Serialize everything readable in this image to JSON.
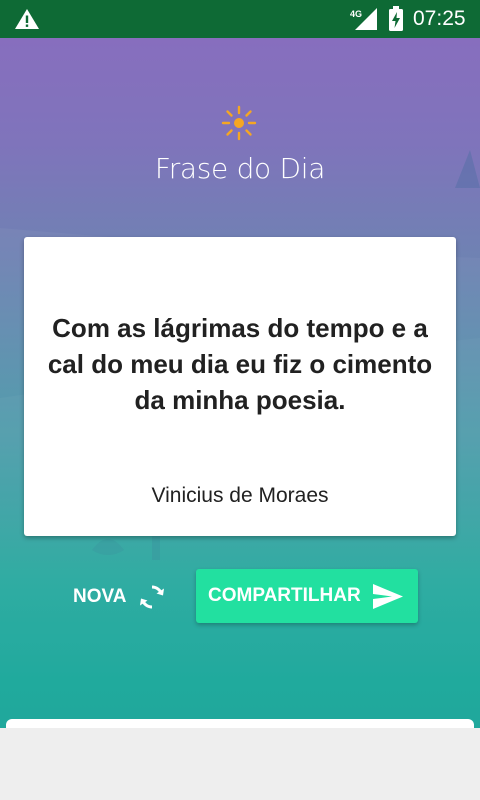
{
  "status_bar": {
    "time": "07:25",
    "network_label": "4G",
    "warning_icon": "warning-icon",
    "signal_icon": "signal-icon",
    "battery_icon": "battery-charging-icon"
  },
  "header": {
    "icon": "sun-icon",
    "title": "Frase do Dia"
  },
  "quote": {
    "text": "Com as lágrimas do tempo e a cal do meu dia eu fiz o cimento da minha poesia.",
    "author": "Vinicius de Moraes"
  },
  "actions": {
    "new_label": "NOVA",
    "new_icon": "refresh-icon",
    "share_label": "COMPARTILHAR",
    "share_icon": "send-icon"
  },
  "colors": {
    "status_bar": "#0e6a35",
    "accent": "#22e0a0",
    "sun": "#f5a623",
    "gradient_top": "#8a6cbf",
    "gradient_bottom": "#0f9f93"
  }
}
